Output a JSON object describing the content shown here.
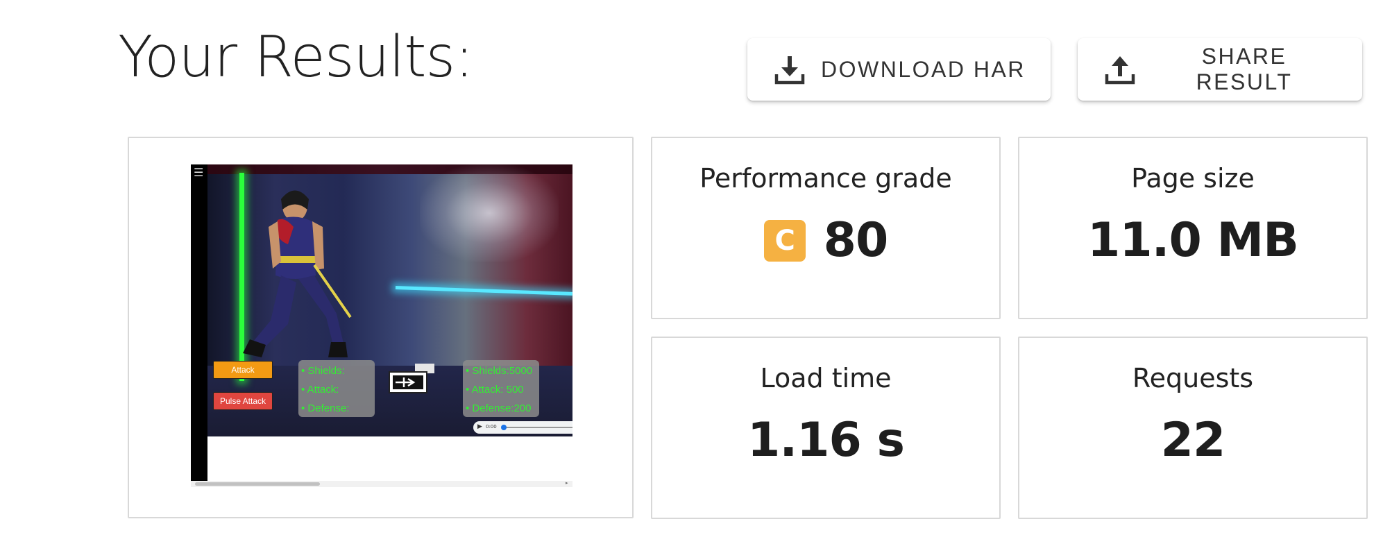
{
  "header": {
    "title": "Your Results:",
    "download_label": "DOWNLOAD HAR",
    "share_label": "SHARE RESULT"
  },
  "metrics": {
    "performance": {
      "label": "Performance grade",
      "grade": "C",
      "value": "80",
      "grade_color": "#f5b142"
    },
    "page_size": {
      "label": "Page size",
      "value": "11.0 MB"
    },
    "load_time": {
      "label": "Load time",
      "value": "1.16 s"
    },
    "requests": {
      "label": "Requests",
      "value": "22"
    }
  },
  "screenshot": {
    "attack_label": "Attack",
    "pulse_label": "Pulse Attack",
    "left_stats": [
      "Shields:",
      "Attack:",
      "Defense:"
    ],
    "right_stats": [
      "Shields:5000",
      "Attack: 500",
      "Defense:200"
    ],
    "audio_time": "0:00"
  },
  "icons": {
    "download": "download-tray-icon",
    "share": "upload-tray-icon",
    "menu": "hamburger-icon"
  }
}
